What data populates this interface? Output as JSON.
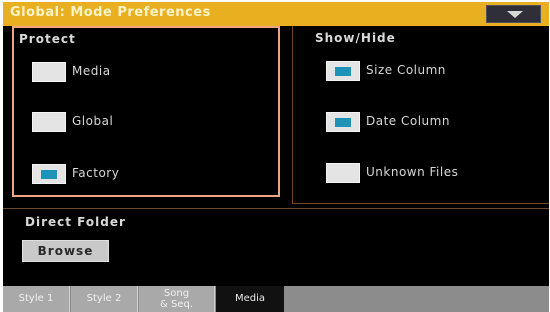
{
  "title": "Global: Mode Preferences",
  "menu": {
    "icon": "triangle-down-icon"
  },
  "protect": {
    "label": "Protect",
    "items": [
      {
        "label": "Media",
        "checked": false
      },
      {
        "label": "Global",
        "checked": false
      },
      {
        "label": "Factory",
        "checked": true
      }
    ]
  },
  "show_hide": {
    "label": "Show/Hide",
    "items": [
      {
        "label": "Size Column",
        "checked": true
      },
      {
        "label": "Date Column",
        "checked": true
      },
      {
        "label": "Unknown Files",
        "checked": false
      }
    ]
  },
  "direct_folder": {
    "label": "Direct Folder",
    "browse_label": "Browse"
  },
  "tabs": [
    {
      "label": "Style 1",
      "active": false
    },
    {
      "label": "Style 2",
      "active": false
    },
    {
      "label": "Song & Seq.",
      "line1": "Song",
      "line2": "& Seq.",
      "active": false
    },
    {
      "label": "Media",
      "active": true
    }
  ],
  "colors": {
    "title_bar": "#e8b020",
    "selection_border": "#f0a582",
    "check_mark": "#1d93b8",
    "background": "#000000"
  }
}
